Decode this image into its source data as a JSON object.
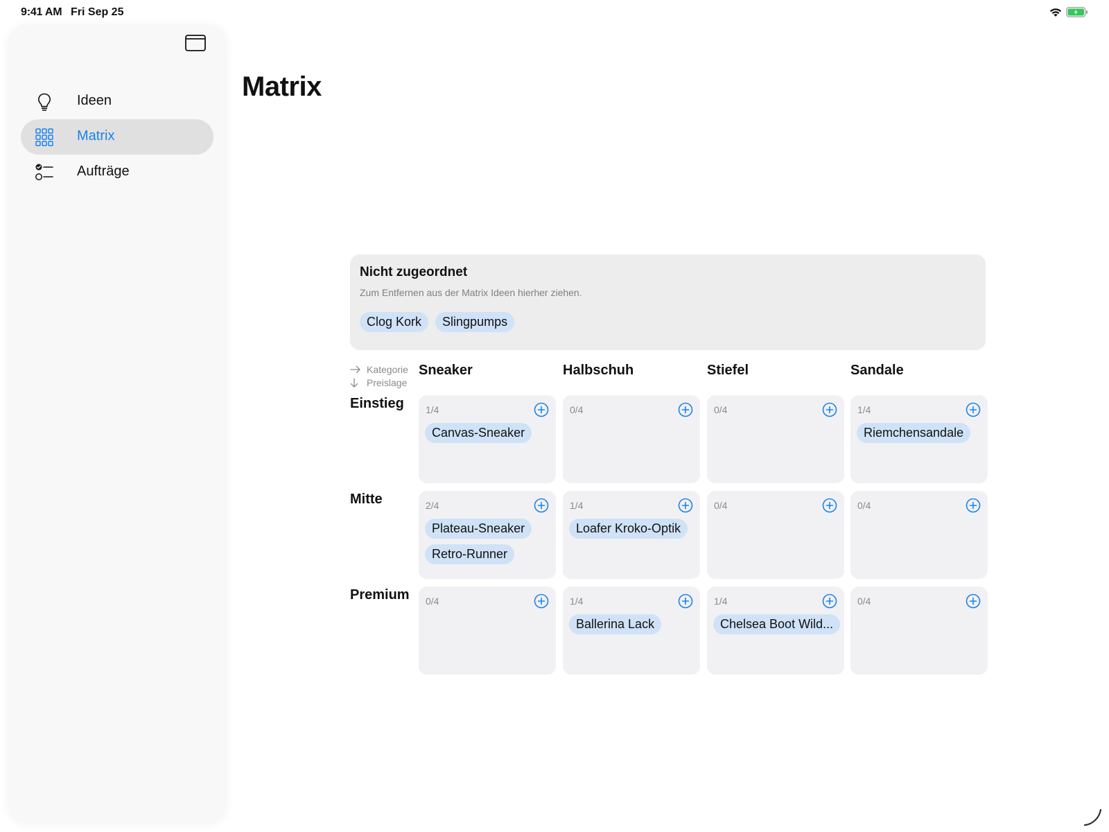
{
  "status_bar": {
    "time": "9:41 AM",
    "date": "Fri Sep 25"
  },
  "sidebar": {
    "items": [
      {
        "label": "Ideen",
        "icon": "lightbulb-icon",
        "active": false
      },
      {
        "label": "Matrix",
        "icon": "grid-icon",
        "active": true
      },
      {
        "label": "Aufträge",
        "icon": "checklist-icon",
        "active": false
      }
    ]
  },
  "main": {
    "title": "Matrix",
    "unassigned": {
      "title": "Nicht zugeordnet",
      "hint": "Zum Entfernen aus der Matrix Ideen hierher ziehen.",
      "items": [
        "Clog Kork",
        "Slingpumps"
      ]
    },
    "axis_legend": {
      "columns_label": "Kategorie",
      "rows_label": "Preislage"
    },
    "columns": [
      "Sneaker",
      "Halbschuh",
      "Stiefel",
      "Sandale"
    ],
    "rows": [
      "Einstieg",
      "Mitte",
      "Premium"
    ],
    "cells": [
      [
        {
          "count": "1/4",
          "items": [
            "Canvas-Sneaker"
          ]
        },
        {
          "count": "0/4",
          "items": []
        },
        {
          "count": "0/4",
          "items": []
        },
        {
          "count": "1/4",
          "items": [
            "Riemchensandale"
          ]
        }
      ],
      [
        {
          "count": "2/4",
          "items": [
            "Plateau-Sneaker",
            "Retro-Runner"
          ]
        },
        {
          "count": "1/4",
          "items": [
            "Loafer Kroko-Optik"
          ]
        },
        {
          "count": "0/4",
          "items": []
        },
        {
          "count": "0/4",
          "items": []
        }
      ],
      [
        {
          "count": "0/4",
          "items": []
        },
        {
          "count": "1/4",
          "items": [
            "Ballerina Lack"
          ]
        },
        {
          "count": "1/4",
          "items": [
            "Chelsea Boot Wild..."
          ]
        },
        {
          "count": "0/4",
          "items": []
        }
      ]
    ]
  },
  "colors": {
    "accent": "#1a82ef",
    "chip": "#cfe2f7",
    "cell": "#f1f1f4",
    "panel": "#ededed"
  }
}
